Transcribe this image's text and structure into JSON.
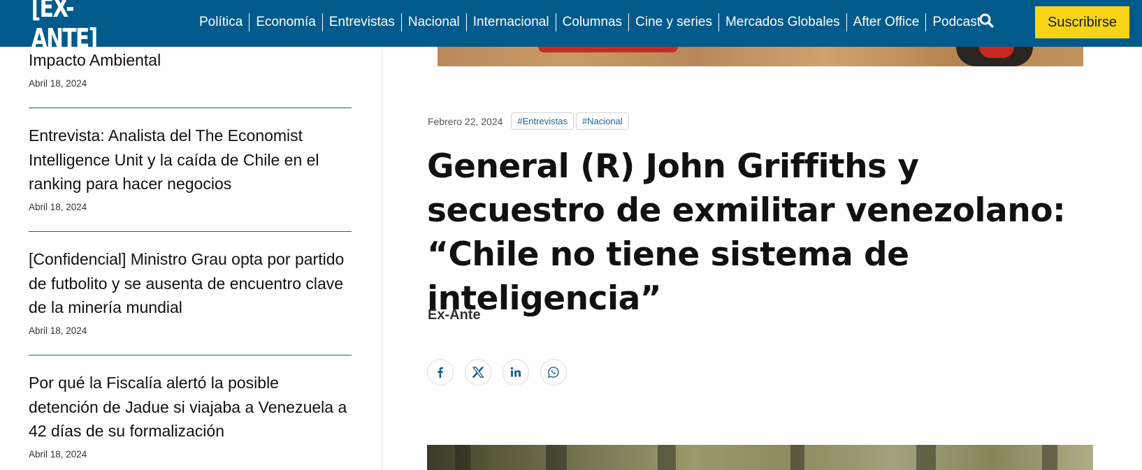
{
  "header": {
    "logo_text": "[EX-ANTE]",
    "nav": [
      "Política",
      "Economía",
      "Entrevistas",
      "Nacional",
      "Internacional",
      "Columnas",
      "Cine y series",
      "Mercados Globales",
      "After Office",
      "Podcast"
    ],
    "subscribe_label": "Suscribirse",
    "search_icon": "search-icon",
    "colors": {
      "bar": "#005a8c",
      "subscribe": "#f7d417"
    }
  },
  "sidebar": {
    "items": [
      {
        "title": "Impacto Ambiental",
        "date": "Abril 18, 2024"
      },
      {
        "title": "Entrevista: Analista del The Economist Intelligence Unit y la caída de Chile en el ranking para hacer negocios",
        "date": "Abril 18, 2024"
      },
      {
        "title": "[Confidencial] Ministro Grau opta por partido de futbolito y se ausenta de encuentro clave de la minería mundial",
        "date": "Abril 18, 2024"
      },
      {
        "title": "Por qué la Fiscalía alertó la posible detención de Jadue si viajaba a Venezuela a 42 días de su formalización",
        "date": "Abril 18, 2024"
      }
    ]
  },
  "article": {
    "date": "Febrero 22, 2024",
    "tags": [
      "#Entrevistas",
      "#Nacional"
    ],
    "headline": "General (R) John Griffiths y secuestro de exmilitar venezolano: “Chile no tiene sistema de inteligencia”",
    "author": "Ex-Ante",
    "share_icons": [
      "facebook-icon",
      "x-icon",
      "linkedin-icon",
      "whatsapp-icon"
    ]
  }
}
